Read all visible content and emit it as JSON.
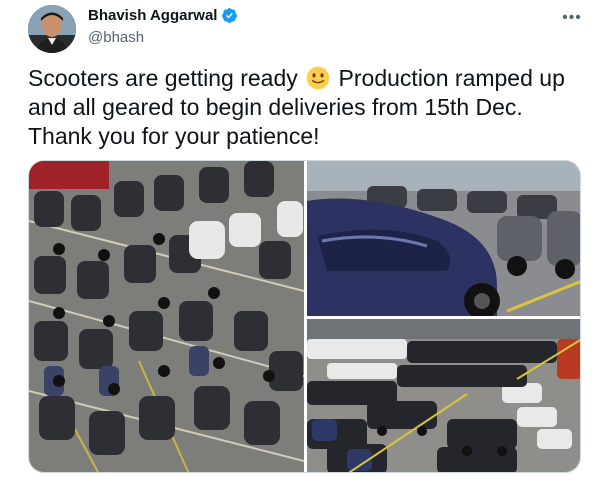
{
  "author": {
    "display_name": "Bhavish Aggarwal",
    "handle": "@bhash",
    "verified": true,
    "avatar_icon": "person-avatar"
  },
  "more_button": {
    "label": "•••",
    "icon": "more-dots-icon"
  },
  "tweet": {
    "text_part1": "Scooters are getting ready ",
    "emoji": "slightly-smiling-face",
    "text_part2": " Production ramped up and all geared to begin deliveries from 15th Dec. Thank you for your patience!"
  },
  "media": {
    "photo_count": 3,
    "photos": [
      {
        "name": "scooter-rows-overhead-photo"
      },
      {
        "name": "blue-scooters-closeup-photo"
      },
      {
        "name": "scooter-factory-floor-photo"
      }
    ]
  },
  "colors": {
    "text": "#0f1419",
    "secondary_text": "#536471",
    "verified_blue": "#1d9bf0",
    "border": "#cfd9de"
  }
}
